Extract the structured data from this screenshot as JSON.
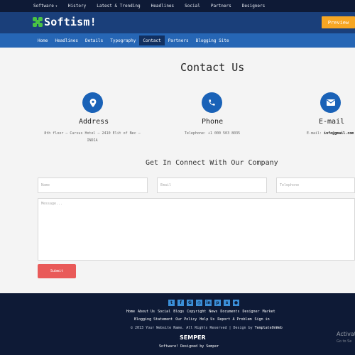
{
  "top_nav": {
    "software": "Software",
    "items": [
      "History",
      "Latest & Trending",
      "Headlines",
      "Social",
      "Partners",
      "Designers"
    ]
  },
  "brand": {
    "name": "Softism!",
    "preview": "Preview"
  },
  "main_nav": {
    "items": [
      "Home",
      "Headlines",
      "Details",
      "Typography",
      "Contact",
      "Partners",
      "Blogging Site"
    ],
    "active": "Contact"
  },
  "page": {
    "title": "Contact Us",
    "contact_cards": [
      {
        "icon": "map-pin-icon",
        "title": "Address",
        "line1": "8th floor – Cursus Hotel – 2410 Elit of Nec –",
        "line2": "INDIA"
      },
      {
        "icon": "phone-icon",
        "title": "Phone",
        "line1": "Telephone: +1 000 503 8035"
      },
      {
        "icon": "envelope-icon",
        "title": "E-mail",
        "label": "E-mail:",
        "value": "info@gmail.com"
      }
    ],
    "form_title": "Get In Connect With Our Company",
    "form": {
      "name_placeholder": "Name",
      "email_placeholder": "Email",
      "phone_placeholder": "Telephone",
      "message_placeholder": "Message...",
      "submit": "Submit"
    }
  },
  "footer": {
    "social_icons": [
      "twitter-icon",
      "facebook-icon",
      "google-plus-icon",
      "instagram-icon",
      "linkedin-icon",
      "pinterest-icon",
      "skype-icon",
      "github-icon"
    ],
    "links": [
      "Home",
      "About Us",
      "Social",
      "Blogs",
      "Copyright",
      "News",
      "Documents",
      "Designer",
      "Market",
      "Blogging Statement",
      "Our Policy",
      "Help Us",
      "Report A Problem",
      "Sign in"
    ],
    "copyright": "© 2013 Your Website Name. All Rights Reserved | Design by",
    "copyright_link": "TemplateOnWeb",
    "brand": "SEMPER",
    "tagline": "Software! Designed by Semper"
  },
  "overlay": {
    "activate": "Activat",
    "go_to": "Go to Se"
  },
  "colors": {
    "top_bar": "#0e1a36",
    "header": "#1a3f7a",
    "nav": "#2666b5",
    "accent_icon": "#1a62b7",
    "preview": "#f6a623",
    "submit": "#e95a59",
    "logo_green": "#49c244"
  }
}
